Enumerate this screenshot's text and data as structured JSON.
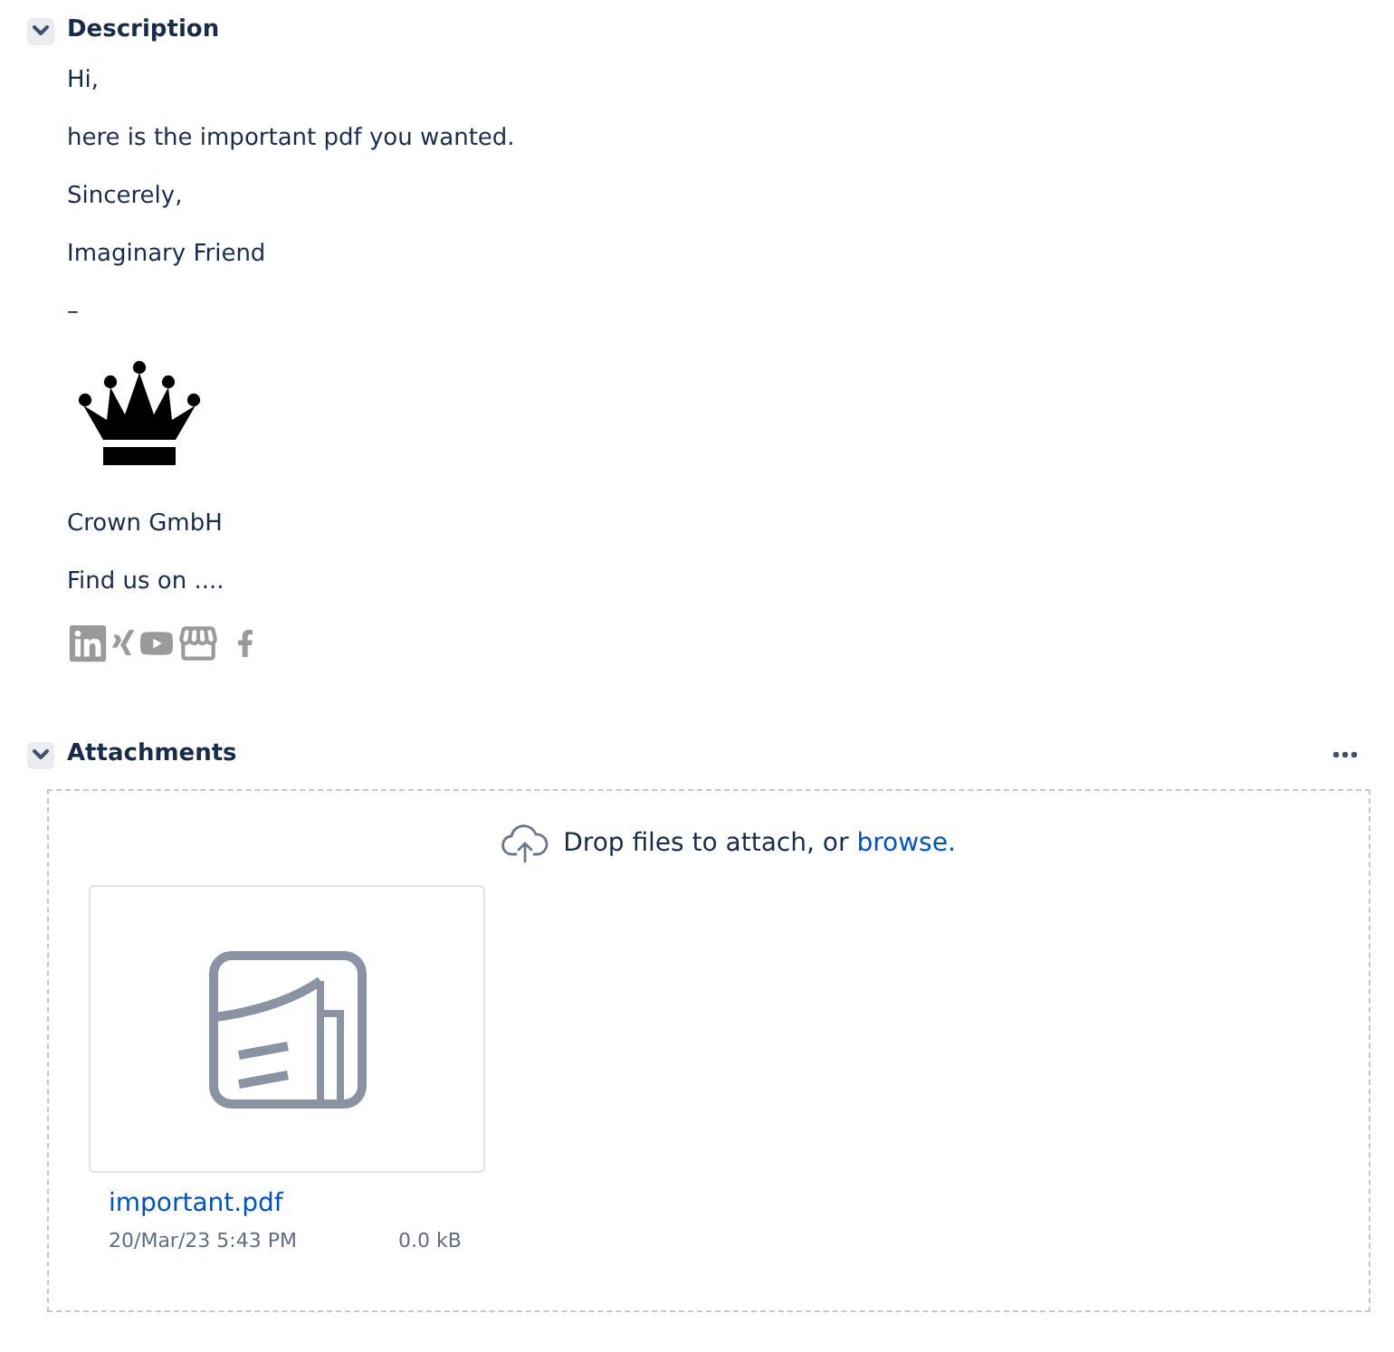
{
  "description": {
    "title": "Description",
    "expanded": true,
    "paragraphs": [
      "Hi,",
      "here is the important pdf you wanted.",
      "Sincerely,",
      "Imaginary Friend",
      "–"
    ],
    "signature": {
      "company": "Crown GmbH",
      "find_us": "Find us on ...."
    }
  },
  "attachments": {
    "title": "Attachments",
    "expanded": true,
    "drop_hint": "Drop files to attach, or",
    "browse_link": "browse.",
    "files": [
      {
        "name": "important.pdf",
        "date": "20/Mar/23 5:43 PM",
        "size": "0.0 kB"
      }
    ]
  }
}
